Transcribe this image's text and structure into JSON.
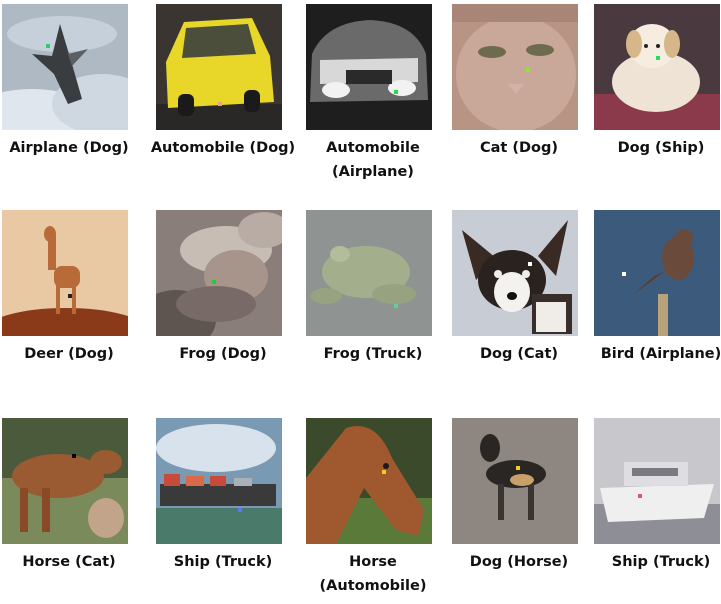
{
  "captions": [
    [
      "Airplane (Dog)",
      "Automobile (Dog)",
      "Automobile\n(Airplane)",
      "Cat (Dog)",
      "Dog (Ship)"
    ],
    [
      "Deer (Dog)",
      "Frog (Dog)",
      "Frog (Truck)",
      "Dog (Cat)",
      "Bird (Airplane)"
    ],
    [
      "Horse (Cat)",
      "Ship (Truck)",
      "Horse\n(Automobile)",
      "Dog (Horse)",
      "Ship (Truck)"
    ]
  ],
  "images": [
    [
      "airplane-over-clouds",
      "yellow-taxi",
      "silver-car-front",
      "cat-face-closeup",
      "small-white-dog"
    ],
    [
      "deer-standing",
      "frog-blurry",
      "frog-gray",
      "chihuahua-dog",
      "bird-on-branch"
    ],
    [
      "brown-horse-with-foal",
      "cargo-ship",
      "horse-head",
      "black-dog-standing",
      "white-boat"
    ]
  ],
  "pixel_colors": [
    [
      "#2ecc71",
      "#f0a080",
      "#22dd44",
      "#88ee22",
      "#22dd66"
    ],
    [
      "#222222",
      "#22cc33",
      "#66cc99",
      "#ffffff",
      "#ffffff"
    ],
    [
      "#000000",
      "#5577ff",
      "#eecc22",
      "#eecc22",
      "#dd5577"
    ]
  ]
}
